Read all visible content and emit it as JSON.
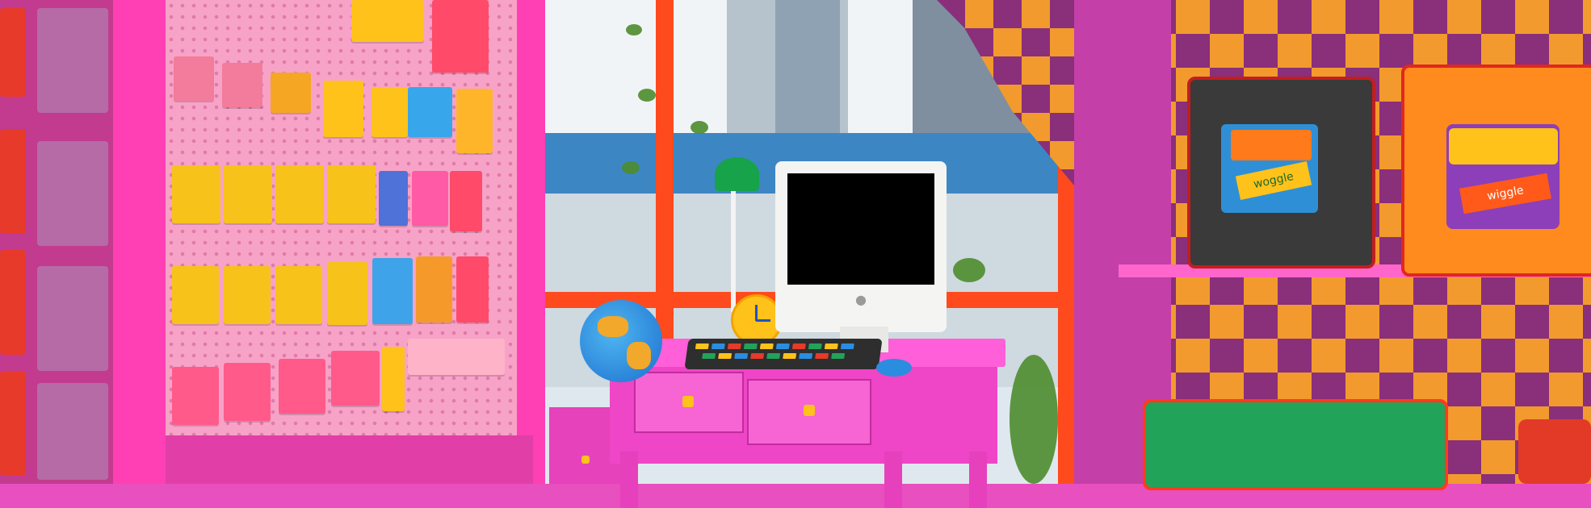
{
  "scene": {
    "description_tags": [
      "retro-toy-shop",
      "pink-interior",
      "desk-with-computer"
    ],
    "colors": {
      "cabinet_pink": "#ff3fb4",
      "window_frame": "#ff4a1e",
      "checker_orange": "#f29a2e",
      "checker_purple": "#8a2f7a",
      "desk_pink": "#ef45c7",
      "knob_yellow": "#ffc21a"
    }
  },
  "labels": {
    "bag_label_left": "woggle",
    "bag_label_right": "wiggle"
  }
}
